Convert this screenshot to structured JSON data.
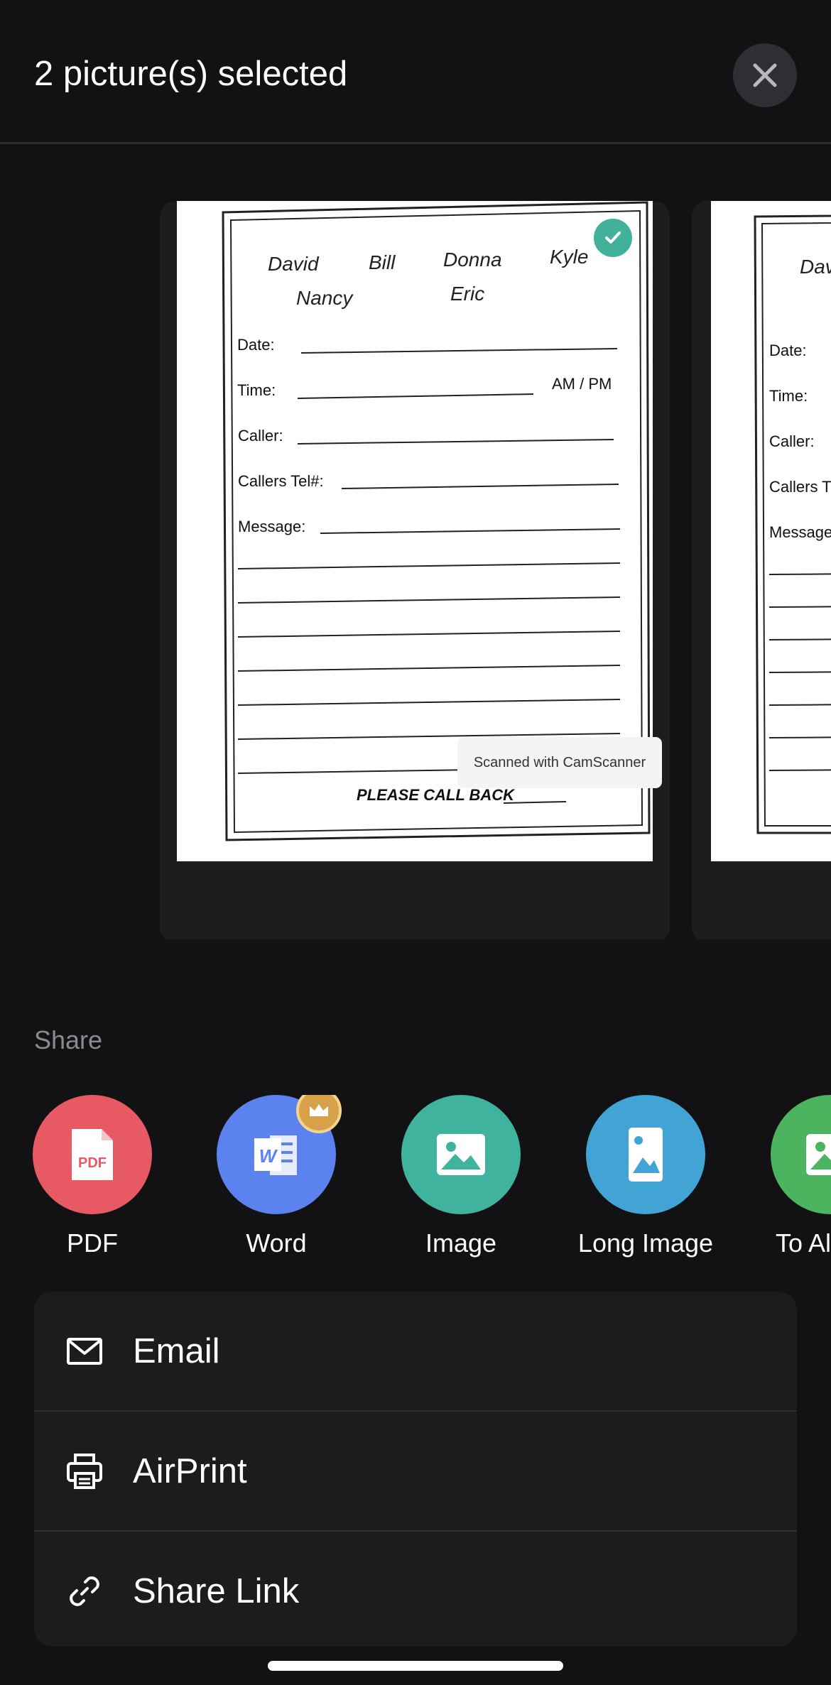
{
  "header": {
    "title": "2 picture(s) selected",
    "close_icon": "close-icon"
  },
  "pages": [
    {
      "selected": true,
      "names_row1": [
        "David",
        "Bill",
        "Donna",
        "Kyle"
      ],
      "names_row2": [
        "Nancy",
        "Eric"
      ],
      "fields": [
        "Date:",
        "Time:",
        "Caller:",
        "Callers Tel#:",
        "Message:"
      ],
      "ampm": "AM / PM",
      "footer": "PLEASE CALL BACK"
    },
    {
      "selected": false,
      "names_row1": [
        "Dav"
      ],
      "fields": [
        "Date:",
        "Time:",
        "Caller:",
        "Callers T",
        "Message"
      ]
    }
  ],
  "watermark": "Scanned with CamScanner",
  "share": {
    "label": "Share",
    "items": [
      {
        "label": "PDF",
        "icon": "pdf-icon",
        "color": "#e85a63",
        "premium": false
      },
      {
        "label": "Word",
        "icon": "word-icon",
        "color": "#5b82ee",
        "premium": true
      },
      {
        "label": "Image",
        "icon": "image-icon",
        "color": "#3fb39d",
        "premium": false
      },
      {
        "label": "Long Image",
        "icon": "long-image-icon",
        "color": "#41a4d5",
        "premium": false
      },
      {
        "label": "To Al",
        "icon": "album-icon",
        "color": "#4cb45e",
        "premium": false
      }
    ]
  },
  "actions": [
    {
      "label": "Email",
      "icon": "mail-icon"
    },
    {
      "label": "AirPrint",
      "icon": "printer-icon"
    },
    {
      "label": "Share Link",
      "icon": "link-icon"
    }
  ]
}
